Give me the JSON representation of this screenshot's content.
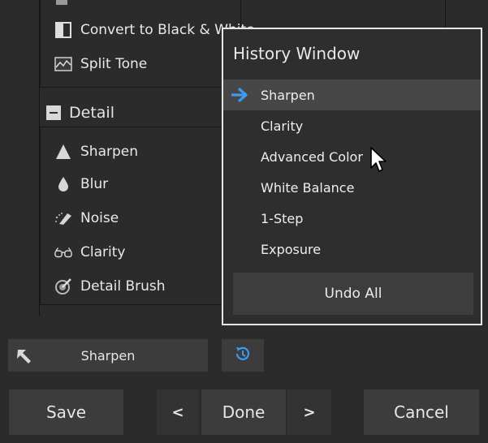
{
  "tools": {
    "color_items": [
      {
        "label": "Convert to Black & White",
        "icon": "black-white-icon"
      },
      {
        "label": "Split Tone",
        "icon": "split-tone-icon"
      }
    ],
    "detail_section": {
      "label": "Detail",
      "items": [
        {
          "label": "Sharpen",
          "icon": "sharpen-icon"
        },
        {
          "label": "Blur",
          "icon": "blur-drop-icon"
        },
        {
          "label": "Noise",
          "icon": "noise-eraser-icon"
        },
        {
          "label": "Clarity",
          "icon": "clarity-glasses-icon"
        },
        {
          "label": "Detail Brush",
          "icon": "detail-brush-icon"
        }
      ]
    }
  },
  "undo_bar": {
    "undo_label": "Sharpen",
    "undo_icon": "undo-arrow-icon",
    "history_icon": "history-icon"
  },
  "footer": {
    "save_label": "Save",
    "prev_label": "<",
    "done_label": "Done",
    "next_label": ">",
    "cancel_label": "Cancel"
  },
  "history_window": {
    "title": "History Window",
    "items": [
      "Sharpen",
      "Clarity",
      "Advanced Color",
      "White Balance",
      "1-Step",
      "Exposure"
    ],
    "active_index": 0,
    "undo_all_label": "Undo All"
  },
  "colors": {
    "background": "#2b2b2b",
    "button": "#3c3c3c",
    "highlight": "#474747",
    "accent_blue": "#3a9bf0",
    "popup_border": "#e6e6e6"
  }
}
